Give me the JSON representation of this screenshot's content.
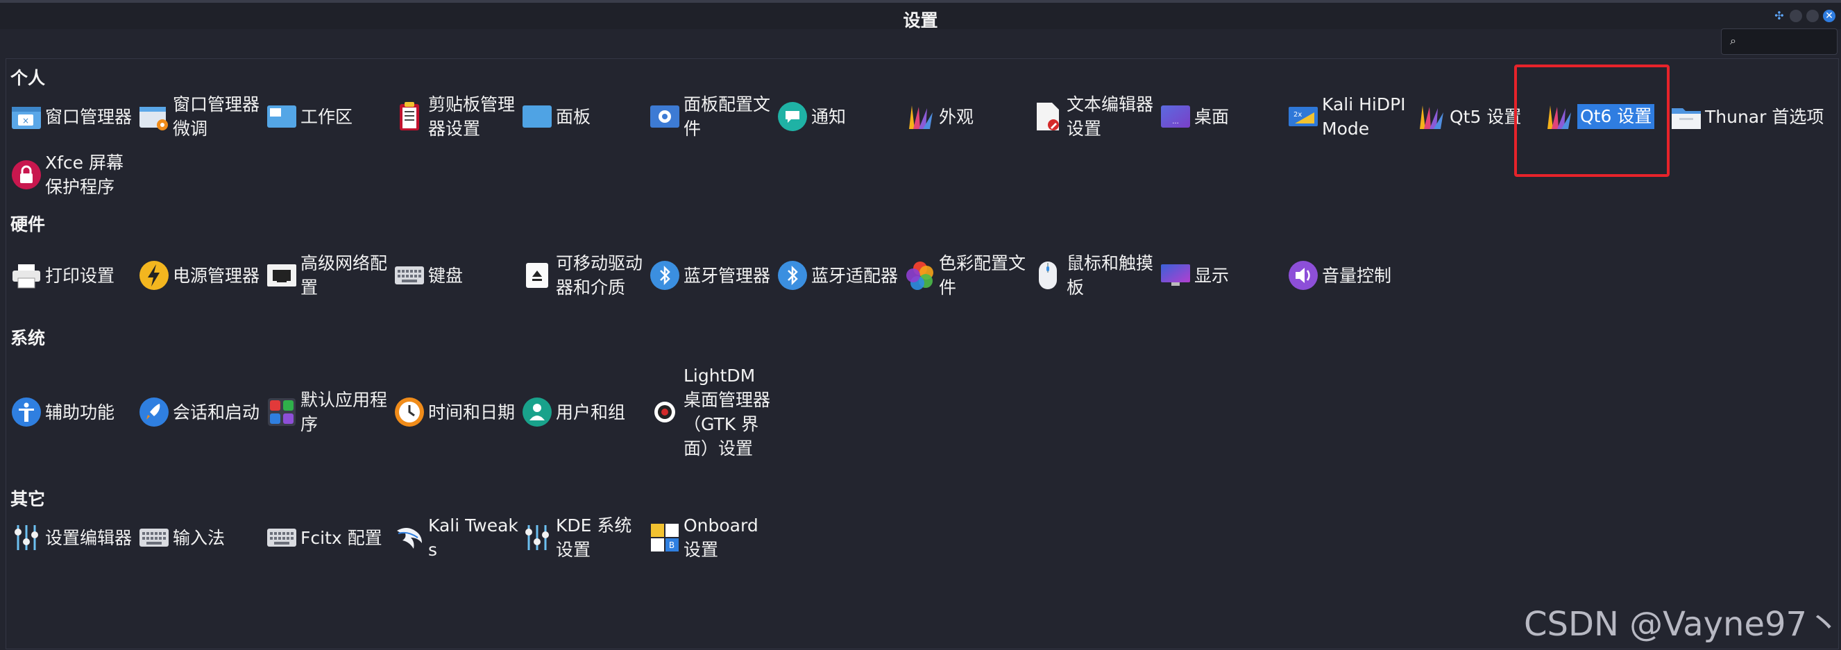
{
  "window": {
    "title": "设置",
    "search_placeholder": ""
  },
  "categories": {
    "personal": "个人",
    "hardware": "硬件",
    "system": "系统",
    "other": "其它"
  },
  "personal": [
    {
      "label": "窗口管理器",
      "icon": "window-manager-icon"
    },
    {
      "label": "窗口管理器微调",
      "icon": "window-tweaks-icon"
    },
    {
      "label": "工作区",
      "icon": "workspaces-icon"
    },
    {
      "label": "剪贴板管理器设置",
      "icon": "clipboard-icon"
    },
    {
      "label": "面板",
      "icon": "panel-icon"
    },
    {
      "label": "面板配置文件",
      "icon": "panel-profiles-icon"
    },
    {
      "label": "通知",
      "icon": "notifications-icon"
    },
    {
      "label": "外观",
      "icon": "appearance-icon"
    },
    {
      "label": "文本编辑器设置",
      "icon": "text-editor-icon"
    },
    {
      "label": "桌面",
      "icon": "desktop-icon"
    },
    {
      "label": "Kali HiDPI Mode",
      "icon": "hidpi-icon"
    },
    {
      "label": "Qt5 设置",
      "icon": "qt5-icon"
    },
    {
      "label": "Qt6 设置",
      "icon": "qt6-icon"
    },
    {
      "label": "Thunar 首选项",
      "icon": "thunar-folder-icon"
    },
    {
      "label": "Xfce 屏幕保护程序",
      "icon": "screensaver-lock-icon"
    }
  ],
  "hardware": [
    {
      "label": "打印设置",
      "icon": "printer-icon"
    },
    {
      "label": "电源管理器",
      "icon": "power-icon"
    },
    {
      "label": "高级网络配置",
      "icon": "network-icon"
    },
    {
      "label": "键盘",
      "icon": "keyboard-icon"
    },
    {
      "label": "可移动驱动器和介质",
      "icon": "removable-drive-icon"
    },
    {
      "label": "蓝牙管理器",
      "icon": "bluetooth-icon"
    },
    {
      "label": "蓝牙适配器",
      "icon": "bluetooth-adapter-icon"
    },
    {
      "label": "色彩配置文件",
      "icon": "color-profile-icon"
    },
    {
      "label": "鼠标和触摸板",
      "icon": "mouse-icon"
    },
    {
      "label": "显示",
      "icon": "display-icon"
    },
    {
      "label": "音量控制",
      "icon": "volume-icon"
    }
  ],
  "system": [
    {
      "label": "辅助功能",
      "icon": "accessibility-icon"
    },
    {
      "label": "会话和启动",
      "icon": "session-rocket-icon"
    },
    {
      "label": "默认应用程序",
      "icon": "default-apps-icon"
    },
    {
      "label": "时间和日期",
      "icon": "clock-icon"
    },
    {
      "label": "用户和组",
      "icon": "users-icon"
    },
    {
      "label": "LightDM 桌面管理器（GTK 界面）设置",
      "icon": "lightdm-icon"
    }
  ],
  "other": [
    {
      "label": "设置编辑器",
      "icon": "settings-editor-icon"
    },
    {
      "label": "输入法",
      "icon": "input-method-keyboard-icon"
    },
    {
      "label": "Fcitx 配置",
      "icon": "fcitx-keyboard-icon"
    },
    {
      "label": "Kali Tweaks",
      "icon": "kali-dragon-icon"
    },
    {
      "label": "KDE 系统设置",
      "icon": "kde-settings-icon"
    },
    {
      "label": "Onboard 设置",
      "icon": "onboard-icon"
    }
  ],
  "selected_item": "Qt6 设置",
  "watermark": "CSDN @Vayne97丶",
  "colors": {
    "background": "#23252f",
    "selection": "#2f7de1",
    "highlight_box": "#e6232a"
  }
}
